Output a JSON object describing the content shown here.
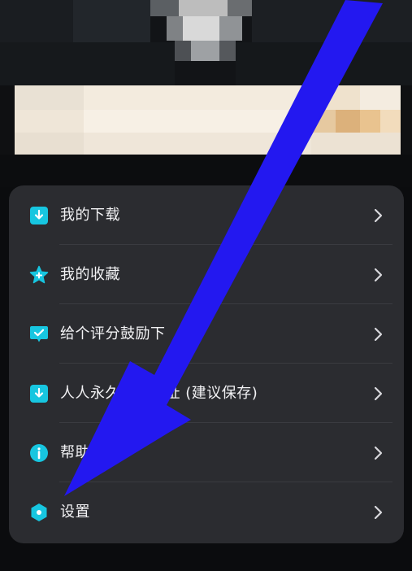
{
  "menu": {
    "items": [
      {
        "label": "我的下载",
        "icon": "download-icon"
      },
      {
        "label": "我的收藏",
        "icon": "star-icon"
      },
      {
        "label": "给个评分鼓励下",
        "icon": "rating-chat-icon"
      },
      {
        "label": "人人永久下载地址 (建议保存)",
        "icon": "download-icon"
      },
      {
        "label": "帮助",
        "icon": "info-icon"
      },
      {
        "label": "设置",
        "icon": "settings-hex-icon"
      }
    ]
  },
  "colors": {
    "card_background": "#2b2c30",
    "accent": "#17c6e0",
    "annotation_arrow": "#2318f0",
    "text": "#f2f2f4"
  }
}
